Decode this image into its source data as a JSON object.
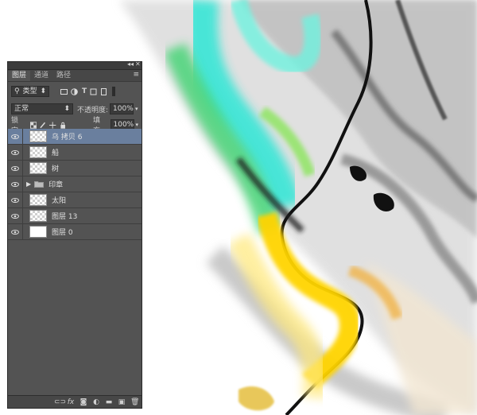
{
  "panel": {
    "collapse_icon": "double-chevron-icon",
    "close_icon": "close-icon",
    "tabs": [
      {
        "label": "图层",
        "active": true
      },
      {
        "label": "通道",
        "active": false
      },
      {
        "label": "路径",
        "active": false
      }
    ],
    "filter": {
      "kind_label": "类型"
    },
    "blend_mode": "正常",
    "opacity_label": "不透明度:",
    "opacity_value": "100%",
    "lock_label": "锁定:",
    "fill_label": "填充:",
    "fill_value": "100%",
    "layers": [
      {
        "name": "乌 拷贝 6",
        "selected": true,
        "thumb": "transparent"
      },
      {
        "name": "船",
        "selected": false,
        "thumb": "transparent"
      },
      {
        "name": "树",
        "selected": false,
        "thumb": "transparent"
      },
      {
        "name": "印章",
        "selected": false,
        "thumb": "folder"
      },
      {
        "name": "太阳",
        "selected": false,
        "thumb": "transparent"
      },
      {
        "name": "图层 13",
        "selected": false,
        "thumb": "transparent"
      },
      {
        "name": "图层 0",
        "selected": false,
        "thumb": "white"
      }
    ],
    "bottom_icons": [
      "link-icon",
      "fx-icon",
      "mask-icon",
      "adjustment-icon",
      "folder-icon",
      "new-layer-icon",
      "trash-icon"
    ]
  },
  "colors": {
    "panel_bg": "#535353",
    "selected_row": "#6a7f9e",
    "canvas_bg": "#ffffff",
    "marble_cyan": "#2ee6d6",
    "marble_green": "#35d36b",
    "marble_yellow": "#ffd400",
    "marble_black": "#111111"
  },
  "bottom_fx_label": "fx"
}
